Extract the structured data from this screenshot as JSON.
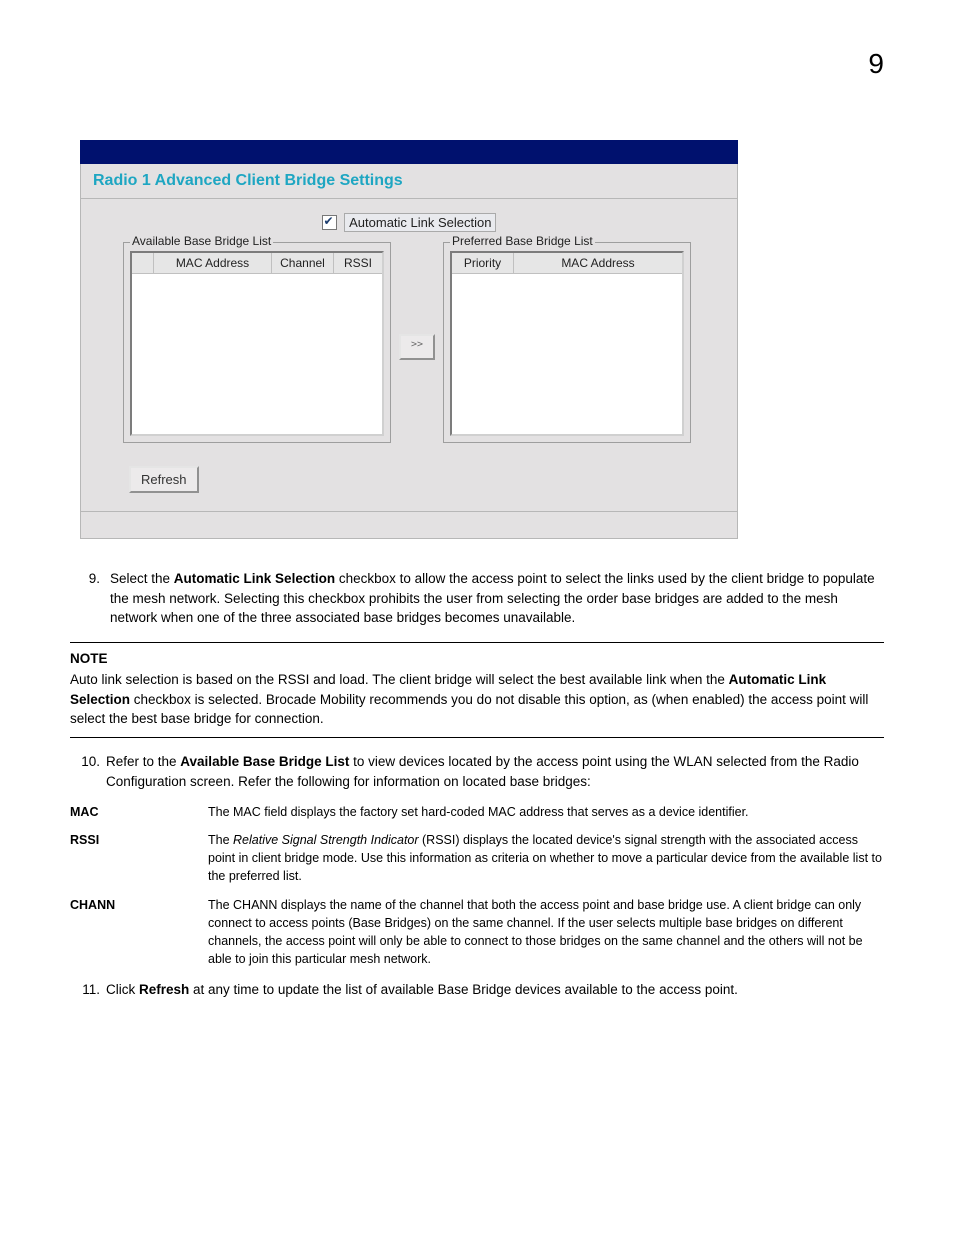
{
  "page_number": "9",
  "ui": {
    "title": "Radio 1 Advanced Client Bridge Settings",
    "auto_label": "Automatic Link Selection",
    "auto_checked": true,
    "avail_legend": "Available Base Bridge List",
    "pref_legend": "Preferred Base Bridge List",
    "col_mac": "MAC Address",
    "col_channel": "Channel",
    "col_rssi": "RSSI",
    "col_priority": "Priority",
    "move_label": ">>",
    "refresh_label": "Refresh"
  },
  "step9": {
    "num": "9.",
    "pre": "Select the ",
    "bold": "Automatic Link Selection",
    "post": " checkbox to allow the access point to select the links used by the client bridge to populate the mesh network. Selecting this checkbox prohibits the user from selecting the order base bridges are added to the mesh network when one of the three associated base bridges becomes unavailable."
  },
  "note": {
    "heading": "NOTE",
    "pre": "Auto link selection is based on the RSSI and load. The client bridge will select the best available link when the ",
    "bold": "Automatic Link Selection",
    "post": " checkbox is selected. Brocade Mobility recommends you do not disable this option, as (when enabled) the access point will select the best base bridge for connection."
  },
  "step10": {
    "num": "10.",
    "pre": "Refer to the ",
    "bold": "Available Base Bridge List",
    "post": " to view devices located by the access point using the WLAN selected from the Radio Configuration screen. Refer the following for information on located base bridges:"
  },
  "defs": {
    "mac": {
      "term": "MAC",
      "desc": "The MAC field displays the factory set hard-coded MAC address that serves as a device identifier."
    },
    "rssi": {
      "term": "RSSI",
      "pre": "The ",
      "ital": "Relative Signal Strength Indicator",
      "post": " (RSSI) displays the located device's signal strength with the associated access point in client bridge mode. Use this information as criteria on whether to move a particular device from the available list to the preferred list."
    },
    "chann": {
      "term": "CHANN",
      "desc": "The CHANN displays the name of the channel that both the\naccess point and base bridge use. A client bridge can only connect to access points (Base Bridges) on the same channel. If the user selects multiple base bridges on different channels, the access point will only be able to connect to those bridges on the same channel and the others will not be able to join this particular mesh network."
    }
  },
  "step11": {
    "num": "11.",
    "pre": "Click ",
    "bold": "Refresh",
    "post": " at any time to update the list of available Base Bridge devices available to the access point."
  }
}
